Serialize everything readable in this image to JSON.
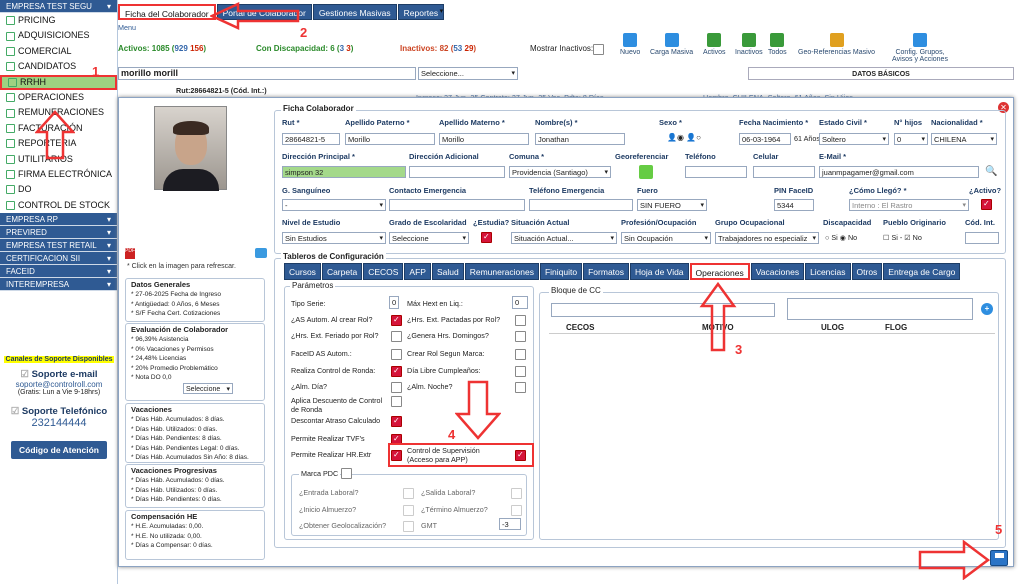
{
  "sidebar": {
    "company": "EMPRESA TEST SEGU",
    "items": [
      "PRICING",
      "ADQUISICIONES",
      "COMERCIAL",
      "CANDIDATOS",
      "RRHH",
      "OPERACIONES",
      "REMUNERACIONES",
      "FACTURACIÓN",
      "REPORTERIA",
      "UTILITARIOS",
      "FIRMA ELECTRÓNICA",
      "DO",
      "CONTROL DE STOCK"
    ],
    "groups": [
      "EMPRESA RP",
      "PREVIRED",
      "EMPRESA TEST RETAIL",
      "CERTIFICACION SII",
      "FACEID",
      "INTEREMPRESA"
    ],
    "support": {
      "title": "Canales de Soporte Disponibles",
      "email_label": "Soporte e-mail",
      "email": "soporte@controlroll.com",
      "email_hours": "(Gratis: Lun a Vie 9-18hrs)",
      "phone_label": "Soporte Telefónico",
      "phone": "232144444",
      "code_button": "Código de Atención"
    }
  },
  "top": {
    "tabs": [
      "Ficha del Colaborador",
      "Portal de Colaborador",
      "Gestiones Masivas",
      "Reportes"
    ],
    "menu": "Menu",
    "stats": {
      "activos": "Activos: 1085 (",
      "activos_m": "929",
      "activos_f": "156",
      "disc": "Con Discapacidad: 6 (",
      "disc_m": "3",
      "disc_f": "3",
      "inact": "Inactivos: 82 (",
      "inact_m": "53",
      "inact_f": "29",
      "mostrar": "Mostrar Inactivos:"
    },
    "toolbar": [
      "Nuevo",
      "Carga Masiva",
      "Activos",
      "Inactivos",
      "Todos",
      "Geo-Referencias Masivo",
      "Config. Grupos, Avisos y Acciones"
    ],
    "search": "morillo morill",
    "select": "Seleccione...",
    "datos_basicos": "DATOS BÁSICOS",
    "row": {
      "rut": "Rut:28664821-5 (Cód. Int.:)",
      "ingreso": "Ingreso: 27-Jun.-25 Contrato: 27-Jun.-25 Vac. Pdte: 8 Días.",
      "desc": "Hombre, CHILENA, Soltero, 61 Años, Sin Hijos."
    }
  },
  "modal": {
    "refresh": "* Click en la imagen para refrescar.",
    "datos_generales": {
      "title": "Datos Generales",
      "lines": [
        "* 27-06-2025 Fecha de Ingreso",
        "* Antigüedad: 0 Años, 6 Meses",
        "* S/F Fecha Cert. Cotizaciones"
      ]
    },
    "evaluacion": {
      "title": "Evaluación de Colaborador",
      "lines": [
        "* 96,39% Asistencia",
        "* 0% Vacaciones y Permisos",
        "* 24,48% Licencias",
        "* 20% Promedio Problemático",
        "* Nota DO 0,0"
      ],
      "select": "Seleccione"
    },
    "vacaciones": {
      "title": "Vacaciones",
      "lines": [
        "* Días Háb. Acumulados: 8 días.",
        "* Días Háb. Utilizados: 0 días.",
        "* Días Háb. Pendientes: 8 días.",
        "* Días Háb. Pendientes Legal: 0 días.",
        "* Días Háb. Acumulados Sin Año: 8 días."
      ]
    },
    "progresivas": {
      "title": "Vacaciones Progresivas",
      "lines": [
        "* Días Háb. Acumulados: 0 días.",
        "* Días Háb. Utilizados: 0 días.",
        "* Días Háb. Pendientes: 0 días."
      ]
    },
    "compensacion": {
      "title": "Compensación HE",
      "lines": [
        "* H.E. Acumuladas: 0,00.",
        "* H.E. No utilizada: 0,00.",
        "* Días a Compensar: 0 días."
      ]
    },
    "ficha": {
      "title": "Ficha Colaborador",
      "rut_l": "Rut *",
      "rut": "28664821-5",
      "pat_l": "Apellido Paterno *",
      "pat": "Morillo",
      "mat_l": "Apellido Materno *",
      "mat": "Morillo",
      "nom_l": "Nombre(s) *",
      "nom": "Jonathan",
      "sexo_l": "Sexo *",
      "fn_l": "Fecha Nacimiento *",
      "fn": "06-03-1964",
      "edad": "61 Años",
      "ec_l": "Estado Civil *",
      "ec": "Soltero",
      "hijos_l": "N° hijos",
      "hijos": "0",
      "nac_l": "Nacionalidad *",
      "nac": "CHILENA",
      "dir_l": "Dirección Principal *",
      "dir": "simpson 32",
      "dira_l": "Dirección Adicional",
      "com_l": "Comuna *",
      "com": "Providencia (Santiago)",
      "geo_l": "Georeferenciar",
      "tel_l": "Teléfono",
      "cel_l": "Celular",
      "mail_l": "E-Mail *",
      "mail": "juanmpagamer@gmail.com",
      "gs_l": "G. Sanguíneo",
      "gs": "-",
      "ce_l": "Contacto Emergencia",
      "te_l": "Teléfono Emergencia",
      "fuero_l": "Fuero",
      "fuero": "SIN FUERO",
      "pin_l": "PIN FaceID",
      "pin": "5344",
      "como_l": "¿Cómo Llegó? *",
      "como": "Interno : El Rastro",
      "activo_l": "¿Activo?",
      "ne_l": "Nivel de Estudio",
      "ne": "Sin Estudios",
      "ge_l": "Grado de Escolaridad",
      "ge": "Seleccione",
      "est_l": "¿Estudia?",
      "sit_l": "Situación Actual",
      "sit": "Situación Actual...",
      "prof_l": "Profesión/Ocupación",
      "prof": "Sin Ocupación",
      "go_l": "Grupo Ocupacional",
      "go": "Trabajadores no especializ",
      "disc_l": "Discapacidad",
      "si": "Si",
      "no": "No",
      "po_l": "Pueblo Originario",
      "cod_l": "Cód. Int."
    },
    "tableros": "Tableros de Configuración",
    "subtabs": [
      "Cursos",
      "Carpeta",
      "CECOS",
      "AFP",
      "Salud",
      "Remuneraciones",
      "Finiquito",
      "Formatos",
      "Hoja de Vida",
      "Operaciones",
      "Vacaciones",
      "Licencias",
      "Otros",
      "Entrega de Cargo"
    ],
    "params": {
      "title": "Parámetros",
      "left": [
        "Tipo Serie:",
        "¿AS Autom. Al crear Rol?",
        "¿Hrs. Ext. Feriado por Rol?",
        "FaceID AS Autom.:",
        "Realiza Control de Ronda:",
        "¿Alm. Día?",
        "Aplica Descuento de Control de Ronda",
        "Descontar Atraso Calculado",
        "Permite Realizar TVF's",
        "Permite Realizar HR.Extr"
      ],
      "right": [
        "Máx Hext en Liq.:",
        "¿Hrs. Ext. Pactadas por Rol?",
        "¿Genera Hrs. Domingos?",
        "Crear Rol Segun Marca:",
        "Día Libre Cumpleaños:",
        "¿Alm. Noche?",
        "",
        "",
        "",
        "Control de Supervisión (Acceso para APP)"
      ],
      "zero": "0",
      "marca": "Marca PDC",
      "marca_items": [
        "¿Entrada Laboral?",
        "¿Salida Laboral?",
        "¿Inicio Almuerzo?",
        "¿Término Almuerzo?",
        "¿Obtener Geolocalización?",
        "GMT"
      ],
      "gmt": "-3"
    },
    "bloque": {
      "title": "Bloque de CC",
      "cols": [
        "CECOS",
        "MOTIVO",
        "ULOG",
        "FLOG"
      ]
    }
  },
  "annot": [
    "1",
    "2",
    "3",
    "4",
    "5"
  ],
  "colors": {
    "accent": "#2f5a93",
    "red": "#e33",
    "green": "#9ed281"
  }
}
